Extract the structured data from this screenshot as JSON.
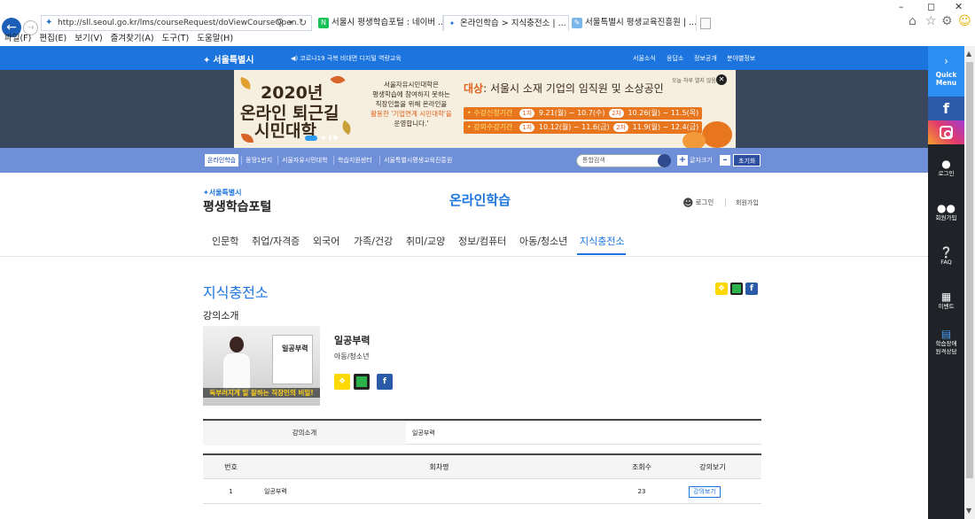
{
  "browser": {
    "address": "http://sll.seoul.go.kr/lms/courseRequest/doViewCourseOpen.",
    "tabs": [
      {
        "label": "서울시 평생학습포털 : 네이버 ..."
      },
      {
        "label": "온라인학습 > 지식충전소 | ..."
      },
      {
        "label": "서울특별시 평생교육진흥원 | ..."
      }
    ],
    "menu": [
      "파일(F)",
      "편집(E)",
      "보기(V)",
      "즐겨찾기(A)",
      "도구(T)",
      "도움말(H)"
    ],
    "window_controls": [
      "–",
      "◻",
      "✕"
    ]
  },
  "topbar": {
    "logo": "서울특별시",
    "news": "◀) 코로나19 극복 비대면 디지털 역량교육",
    "links": [
      "서울소식",
      "응답소",
      "정보공개",
      "분야별정보"
    ]
  },
  "banner": {
    "year": "2020년",
    "title_line1": "온라인 퇴근길",
    "title_line2": "시민대학",
    "desc_line1": "서울자유시민대학은",
    "desc_line2": "평생학습에 참여하지 못하는",
    "desc_line3": "직장인들을 위해 온라인을",
    "desc_line4": "활용한 '기업연계 시민대학'을",
    "desc_line5": "운영합니다.'",
    "target_label": "대상",
    "target_text": ": 서울시 소재 기업의 임직원 및 소상공인",
    "apply_label": "• 수강신청기간",
    "apply_1_chip": "1차",
    "apply_1": "9.21(월) ~ 10.7(수)",
    "apply_2_chip": "2차",
    "apply_2": "10.26(월) ~ 11.5(목)",
    "study_label": "• 강의수강기간",
    "study_1_chip": "1차",
    "study_1": "10.12(월) ~ 11.6(금)",
    "study_2_chip": "2차",
    "study_2": "11.9(월) ~ 12.4(금)",
    "no_more": "오늘 하루 열지 않음",
    "close": "✕"
  },
  "gnb": {
    "items": [
      "온라인학습",
      "몽땅1번지",
      "서울자유시민대학",
      "학습지원센터",
      "서울특별시평생교육진흥원"
    ],
    "search_placeholder": "통합검색",
    "font_size_label": "글자크기",
    "plus": "+",
    "minus": "–",
    "reset": "초기화"
  },
  "header": {
    "logo_small": "서울특별시",
    "portal_title": "평생학습포털",
    "page_heading": "온라인학습",
    "login": "로그인",
    "join": "회원가입"
  },
  "categories": [
    "인문학",
    "취업/자격증",
    "외국어",
    "가족/건강",
    "취미/교양",
    "정보/컴퓨터",
    "아동/청소년",
    "지식충전소"
  ],
  "content": {
    "section_title": "지식충전소",
    "intro_heading": "강의소개",
    "course_title": "일공부력",
    "course_category": "아동/청소년",
    "thumb_board_title": "일공부력",
    "thumb_caption": "독부러지게 일 잘하는 직장인의 비밀!",
    "info_label": "강의소개",
    "info_value": "일공부력",
    "table": {
      "headers": [
        "번호",
        "회차명",
        "조회수",
        "강의보기"
      ],
      "rows": [
        {
          "no": "1",
          "name": "일공부력",
          "views": "23",
          "button": "강의보기"
        }
      ]
    }
  },
  "quick_menu": {
    "title_line1": "Quick",
    "title_line2": "Menu",
    "items": [
      {
        "label": "로그인",
        "icon": "person-icon"
      },
      {
        "label": "회원가입",
        "icon": "people-icon"
      },
      {
        "label": "FAQ",
        "icon": "question-icon"
      },
      {
        "label": "이벤트",
        "icon": "calendar-icon"
      },
      {
        "label_line1": "학습장애",
        "label_line2": "원격상담",
        "icon": "monitor-icon"
      }
    ]
  },
  "colors": {
    "brand_blue": "#1c74de",
    "gnb_bar": "#6f8fd8",
    "quick_menu_bg": "#1f2226",
    "banner_accent": "#e8761f"
  }
}
